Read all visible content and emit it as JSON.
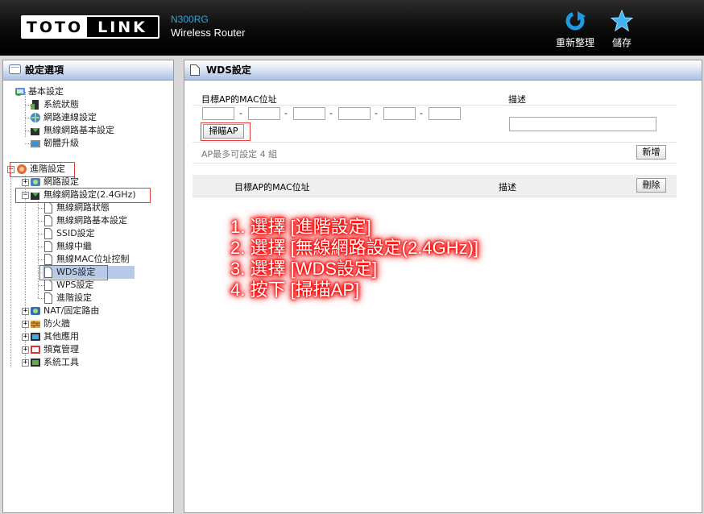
{
  "header": {
    "logo_left": "TOTO",
    "logo_right": "LINK",
    "model": "N300RG",
    "product": "Wireless Router",
    "refresh_label": "重新整理",
    "save_label": "儲存",
    "refresh_icon": "refresh-icon",
    "save_icon": "star-icon"
  },
  "sidebar": {
    "title": "設定選項",
    "basic": {
      "label": "基本設定",
      "items": [
        "系統狀態",
        "網路連線設定",
        "無線網路基本設定",
        "韌體升級"
      ]
    },
    "advanced": {
      "label": "進階設定",
      "network": "網路設定",
      "wireless": {
        "label": "無線網路設定(2.4GHz)",
        "items": [
          "無線網路狀態",
          "無線網路基本設定",
          "SSID設定",
          "無線中繼",
          "無線MAC位址控制",
          "WDS設定",
          "WPS設定",
          "進階設定"
        ],
        "selected": "WDS設定"
      },
      "more": [
        "NAT/固定路由",
        "防火牆",
        "其他應用",
        "頻寬管理",
        "系統工具"
      ]
    }
  },
  "content": {
    "title": "WDS設定",
    "mac_label": "目標AP的MAC位址",
    "desc_label": "描述",
    "mac_separator": "-",
    "scan_button": "掃瞄AP",
    "limit_note": "AP最多可設定 4 組",
    "add_button": "新增",
    "list_mac_header": "目標AP的MAC位址",
    "list_desc_header": "描述",
    "delete_button": "刪除",
    "mac_values": [
      "",
      "",
      "",
      "",
      "",
      ""
    ],
    "desc_value": ""
  },
  "annotation": {
    "lines": [
      "1. 選擇 [進階設定]",
      "2. 選擇 [無線網路設定(2.4GHz)]",
      "3. 選擇 [WDS設定]",
      "4. 按下 [掃描AP]"
    ],
    "color": "#ff0000"
  }
}
